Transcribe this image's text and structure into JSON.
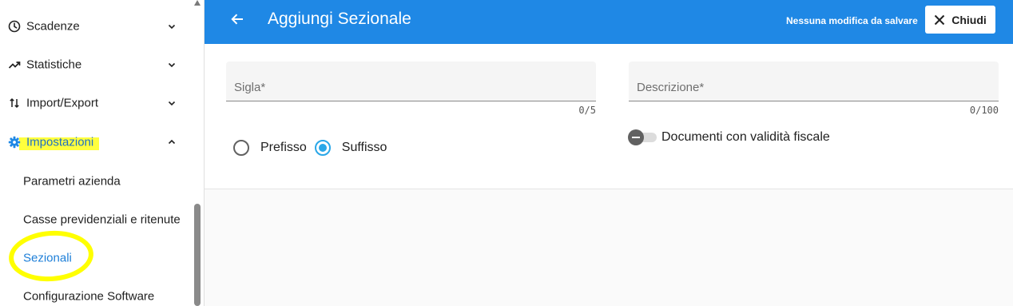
{
  "sidebar": {
    "items": [
      {
        "label": "Scadenze",
        "icon": "clock-icon"
      },
      {
        "label": "Statistiche",
        "icon": "trending-up-icon"
      },
      {
        "label": "Import/Export",
        "icon": "import-export-icon"
      },
      {
        "label": "Impostazioni",
        "icon": "gear-icon",
        "expanded": true
      }
    ],
    "subitems": [
      {
        "label": "Parametri azienda"
      },
      {
        "label": "Casse previdenziali e ritenute"
      },
      {
        "label": "Sezionali",
        "active": true
      },
      {
        "label": "Configurazione Software"
      }
    ],
    "highlight_color": "#ffff00"
  },
  "header": {
    "title": "Aggiungi Sezionale",
    "status": "Nessuna modifica da salvare",
    "close_label": "Chiudi",
    "color": "#1f88e5"
  },
  "form": {
    "sigla": {
      "label": "Sigla*",
      "value": "",
      "counter": "0/5"
    },
    "descrizione": {
      "label": "Descrizione*",
      "value": "",
      "counter": "0/100"
    },
    "position": {
      "options": [
        "Prefisso",
        "Suffisso"
      ],
      "selected": "Suffisso"
    },
    "fiscal_toggle": {
      "label": "Documenti con validità fiscale",
      "on": false
    }
  }
}
